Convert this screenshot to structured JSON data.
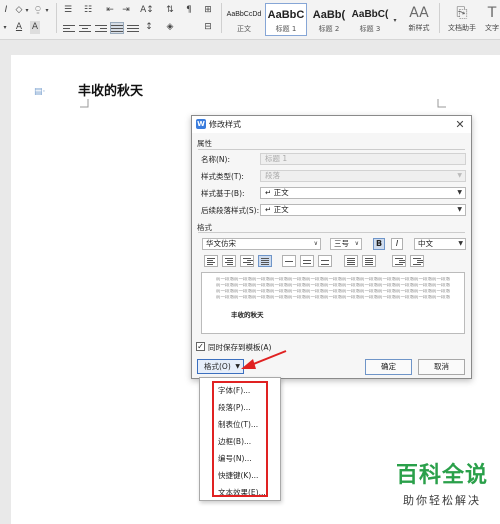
{
  "ribbon": {
    "styles": [
      {
        "sample": "AaBbCcDd",
        "name": "正文"
      },
      {
        "sample": "AaBbC",
        "name": "标题 1"
      },
      {
        "sample": "AaBb(",
        "name": "标题 2"
      },
      {
        "sample": "AaBbC(",
        "name": "标题 3"
      }
    ],
    "new_style_label": "新样式",
    "doc_assistant_label": "文档助手",
    "text_tools_label": "文字"
  },
  "document": {
    "heading": "丰收的秋天"
  },
  "dialog": {
    "title": "修改样式",
    "properties_group": "属性",
    "name_label": "名称(N):",
    "name_value": "标题 1",
    "style_type_label": "样式类型(T):",
    "style_type_value": "段落",
    "based_on_label": "样式基于(B):",
    "based_on_value": "↵ 正文",
    "following_label": "后续段落样式(S):",
    "following_value": "↵ 正文",
    "format_group": "格式",
    "font": "华文仿宋",
    "size": "三号",
    "bold": "B",
    "italic": "I",
    "script": "中文",
    "preview_text": "前一段落前一段落前一段落前一段落前一段落前一段落前一段落前一段落前一段落前一段落前一段落前一段落前一段落",
    "preview_heading": "丰收的秋天",
    "save_to_template": "同时保存到模板(A)",
    "format_button": "格式(O)",
    "ok": "确定",
    "cancel": "取消"
  },
  "format_menu": {
    "items": [
      "字体(F)...",
      "段落(P)...",
      "制表位(T)...",
      "边框(B)...",
      "编号(N)...",
      "快捷键(K)...",
      "文本效果(E)..."
    ]
  },
  "watermark": {
    "title": "百科全说",
    "subtitle": "助你轻松解决"
  },
  "colors": {
    "accent": "#3b6fbf",
    "annotation": "#e02222",
    "watermark": "#2aa04a"
  }
}
